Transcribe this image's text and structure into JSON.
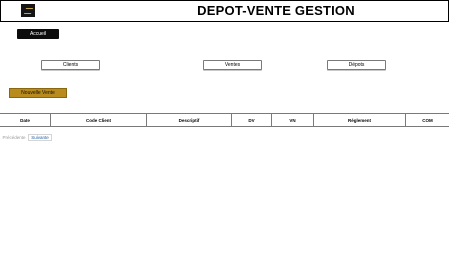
{
  "header": {
    "title": "DEPOT-VENTE GESTION",
    "logo_icon": "brand-logo-icon"
  },
  "nav": {
    "home_label": "Accueil",
    "clients_label": "Clients",
    "ventes_label": "Ventes",
    "depots_label": "Dépots"
  },
  "actions": {
    "new_sale_label": "Nouvelle Vente"
  },
  "table": {
    "columns": [
      "Date",
      "Code Client",
      "Descriptif",
      "DV",
      "VN",
      "Réglement",
      "COM"
    ],
    "rows": []
  },
  "pagination": {
    "prev_label": "Précédente",
    "next_label": "Suivante"
  },
  "colors": {
    "accent_gold": "#b88b1c",
    "button_dark": "#0c0c0c",
    "link_blue": "#1f5fa8"
  }
}
